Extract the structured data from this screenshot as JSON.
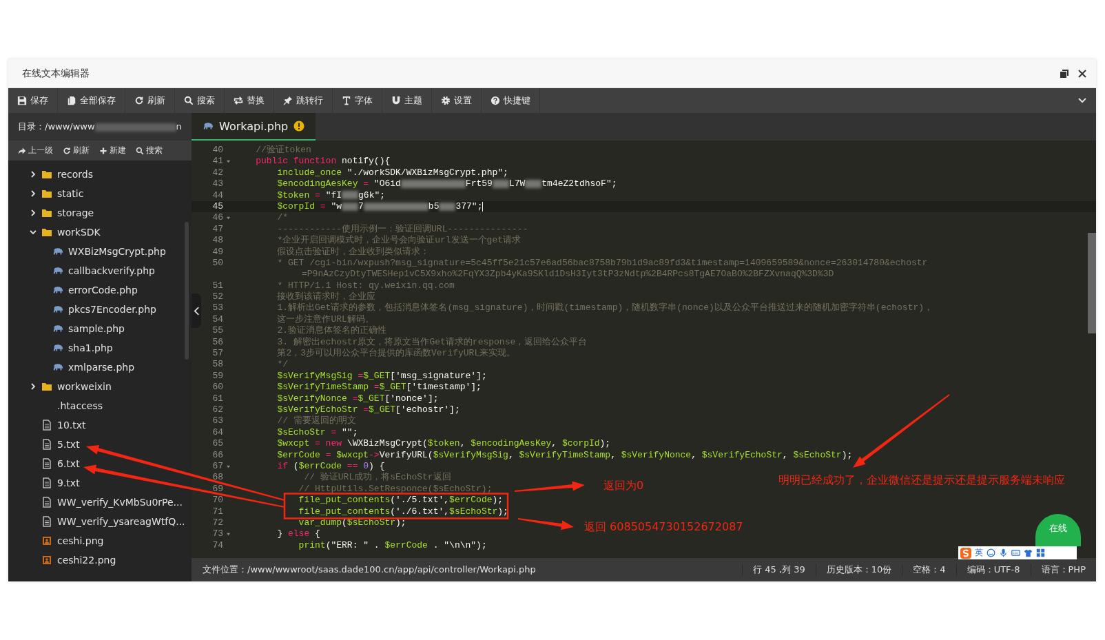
{
  "window": {
    "title": "在线文本编辑器"
  },
  "toolbar": [
    {
      "kind": "save",
      "label": "保存"
    },
    {
      "kind": "save-all",
      "label": "全部保存"
    },
    {
      "kind": "refresh",
      "label": "刷新"
    },
    {
      "kind": "search",
      "label": "搜索"
    },
    {
      "kind": "replace",
      "label": "替换"
    },
    {
      "kind": "goto",
      "label": "跳转行"
    },
    {
      "kind": "font",
      "label": "字体"
    },
    {
      "kind": "theme",
      "label": "主题"
    },
    {
      "kind": "settings",
      "label": "设置"
    },
    {
      "kind": "help",
      "label": "快捷键"
    }
  ],
  "sidebar": {
    "path": {
      "label": "目录：/www/www",
      "tail": "n"
    },
    "tools": [
      {
        "kind": "up",
        "label": "上一级"
      },
      {
        "kind": "refresh",
        "label": "刷新"
      },
      {
        "kind": "new",
        "label": "新建"
      },
      {
        "kind": "search",
        "label": "搜索"
      }
    ],
    "tree": [
      {
        "name": "records",
        "kind": "folder",
        "expanded": false
      },
      {
        "name": "static",
        "kind": "folder",
        "expanded": false
      },
      {
        "name": "storage",
        "kind": "folder",
        "expanded": false
      },
      {
        "name": "workSDK",
        "kind": "folder",
        "expanded": true,
        "children": [
          {
            "name": "WXBizMsgCrypt.php",
            "kind": "php"
          },
          {
            "name": "callbackverify.php",
            "kind": "php"
          },
          {
            "name": "errorCode.php",
            "kind": "php"
          },
          {
            "name": "pkcs7Encoder.php",
            "kind": "php"
          },
          {
            "name": "sample.php",
            "kind": "php"
          },
          {
            "name": "sha1.php",
            "kind": "php"
          },
          {
            "name": "xmlparse.php",
            "kind": "php"
          }
        ]
      },
      {
        "name": "workweixin",
        "kind": "folder",
        "expanded": false
      },
      {
        "name": ".htaccess",
        "kind": "plain"
      },
      {
        "name": "10.txt",
        "kind": "text"
      },
      {
        "name": "5.txt",
        "kind": "text"
      },
      {
        "name": "6.txt",
        "kind": "text"
      },
      {
        "name": "9.txt",
        "kind": "text"
      },
      {
        "name": "WW_verify_KvMbSu0rPe...",
        "kind": "text"
      },
      {
        "name": "WW_verify_ysareagWtfQ...",
        "kind": "text"
      },
      {
        "name": "ceshi.png",
        "kind": "image"
      },
      {
        "name": "ceshi22.png",
        "kind": "image"
      }
    ]
  },
  "tabs": [
    {
      "label": "Workapi.php",
      "selected": true,
      "warning": true
    }
  ],
  "code": {
    "lines": [
      {
        "number": "40",
        "current": false,
        "segments": [
          {
            "text": "    //验证token",
            "kind": "comment"
          }
        ]
      },
      {
        "number": "41",
        "fold": true,
        "current": false,
        "segments": [
          {
            "text": "    public function ",
            "kind": "keyword"
          },
          {
            "text": "notify(){",
            "kind": "plain"
          }
        ]
      },
      {
        "number": "42",
        "current": false,
        "segments": [
          {
            "text": "        include_once ",
            "kind": "var"
          },
          {
            "text": "\"./workSDK/WXBizMsgCrypt.php\";",
            "kind": "plain"
          }
        ]
      },
      {
        "number": "43",
        "current": false,
        "segments": [
          {
            "text": "        $encodingAesKey",
            "kind": "var"
          },
          {
            "text": " = ",
            "kind": "keyword"
          },
          {
            "text": "\"O6id",
            "kind": "plain"
          },
          {
            "kind": "redacted-long"
          },
          {
            "text": "Frt59",
            "kind": "plain"
          },
          {
            "kind": "redacted-short"
          },
          {
            "text": "L7W",
            "kind": "plain"
          },
          {
            "kind": "redacted-short"
          },
          {
            "text": "tm4eZ2tdhsoF\";",
            "kind": "plain"
          }
        ]
      },
      {
        "number": "44",
        "current": false,
        "segments": [
          {
            "text": "        $token",
            "kind": "var"
          },
          {
            "text": " = ",
            "kind": "keyword"
          },
          {
            "text": "\"fI",
            "kind": "plain"
          },
          {
            "kind": "redacted-short"
          },
          {
            "text": "g6k\";",
            "kind": "plain"
          }
        ]
      },
      {
        "number": "45",
        "current": true,
        "segments": [
          {
            "text": "        $corpId",
            "kind": "var"
          },
          {
            "text": " = ",
            "kind": "keyword"
          },
          {
            "text": "\"w",
            "kind": "plain"
          },
          {
            "kind": "redacted-short"
          },
          {
            "text": "7",
            "kind": "plain"
          },
          {
            "kind": "redacted-long"
          },
          {
            "text": "b5",
            "kind": "plain"
          },
          {
            "kind": "redacted-short"
          },
          {
            "text": "377\";",
            "kind": "plain"
          }
        ]
      },
      {
        "number": "46",
        "fold": true,
        "current": false,
        "segments": [
          {
            "text": "        /*",
            "kind": "comment"
          }
        ]
      },
      {
        "number": "47",
        "current": false,
        "segments": [
          {
            "text": "        ------------使用示例一：验证回调URL---------------",
            "kind": "comment"
          }
        ]
      },
      {
        "number": "48",
        "current": false,
        "segments": [
          {
            "text": "        *企业开启回调模式时，企业号会向验证url发送一个get请求",
            "kind": "comment"
          }
        ]
      },
      {
        "number": "49",
        "current": false,
        "segments": [
          {
            "text": "        假设点击验证时，企业收到类似请求：",
            "kind": "comment"
          }
        ]
      },
      {
        "number": "50",
        "current": false,
        "segments": [
          {
            "text": "        * GET /cgi-bin/wxpush?msg_signature=5c45ff5e21c57e6ad56bac8758b79b1d9ac89fd3&timestamp=1409659589&nonce=263014780&echostr",
            "kind": "comment"
          }
        ],
        "wrap": "=P9nAzCzyDtyTWESHep1vC5X9xho%2FqYX3Zpb4yKa9SKld1DsH3Iyt3tP3zNdtp%2B4RPcs8TgAE7OaBO%2BFZXvnaqQ%3D%3D"
      },
      {
        "number": "51",
        "current": false,
        "segments": [
          {
            "text": "        * HTTP/1.1 Host: qy.weixin.qq.com",
            "kind": "comment"
          }
        ]
      },
      {
        "number": "52",
        "current": false,
        "segments": [
          {
            "text": "        接收到该请求时，企业应",
            "kind": "comment"
          }
        ]
      },
      {
        "number": "53",
        "current": false,
        "segments": [
          {
            "text": "        1.解析出Get请求的参数，包括消息体签名(msg_signature)，时间戳(timestamp)，随机数字串(nonce)以及公众平台推送过来的随机加密字符串(echostr)，",
            "kind": "comment"
          }
        ]
      },
      {
        "number": "54",
        "current": false,
        "segments": [
          {
            "text": "        这一步注意作URL解码。",
            "kind": "comment"
          }
        ]
      },
      {
        "number": "55",
        "current": false,
        "segments": [
          {
            "text": "        2.验证消息体签名的正确性",
            "kind": "comment"
          }
        ]
      },
      {
        "number": "56",
        "current": false,
        "segments": [
          {
            "text": "        3. 解密出echostr原文，将原文当作Get请求的response，返回给公众平台",
            "kind": "comment"
          }
        ]
      },
      {
        "number": "57",
        "current": false,
        "segments": [
          {
            "text": "        第2，3步可以用公众平台提供的库函数VerifyURL来实现。",
            "kind": "comment"
          }
        ]
      },
      {
        "number": "58",
        "current": false,
        "segments": [
          {
            "text": "        */",
            "kind": "comment"
          }
        ]
      },
      {
        "number": "59",
        "current": false,
        "segments": [
          {
            "text": "        $sVerifyMsgSig ",
            "kind": "var"
          },
          {
            "text": "=",
            "kind": "keyword"
          },
          {
            "text": "$_GET",
            "kind": "var"
          },
          {
            "text": "['msg_signature'];",
            "kind": "plain"
          }
        ]
      },
      {
        "number": "60",
        "current": false,
        "segments": [
          {
            "text": "        $sVerifyTimeStamp ",
            "kind": "var"
          },
          {
            "text": "=",
            "kind": "keyword"
          },
          {
            "text": "$_GET",
            "kind": "var"
          },
          {
            "text": "['timestamp'];",
            "kind": "plain"
          }
        ]
      },
      {
        "number": "61",
        "current": false,
        "segments": [
          {
            "text": "        $sVerifyNonce ",
            "kind": "var"
          },
          {
            "text": "=",
            "kind": "keyword"
          },
          {
            "text": "$_GET",
            "kind": "var"
          },
          {
            "text": "['nonce'];",
            "kind": "plain"
          }
        ]
      },
      {
        "number": "62",
        "current": false,
        "segments": [
          {
            "text": "        $sVerifyEchoStr ",
            "kind": "var"
          },
          {
            "text": "=",
            "kind": "keyword"
          },
          {
            "text": "$_GET",
            "kind": "var"
          },
          {
            "text": "['echostr'];",
            "kind": "plain"
          }
        ]
      },
      {
        "number": "63",
        "current": false,
        "segments": [
          {
            "text": "        // 需要返回的明文",
            "kind": "comment"
          }
        ]
      },
      {
        "number": "64",
        "current": false,
        "segments": [
          {
            "text": "        $sEchoStr",
            "kind": "var"
          },
          {
            "text": " = ",
            "kind": "keyword"
          },
          {
            "text": "\"\";",
            "kind": "plain"
          }
        ]
      },
      {
        "number": "65",
        "current": false,
        "segments": [
          {
            "text": "        $wxcpt",
            "kind": "var"
          },
          {
            "text": " = new ",
            "kind": "keyword"
          },
          {
            "text": "\\WXBizMsgCrypt(",
            "kind": "plain"
          },
          {
            "text": "$token",
            "kind": "var"
          },
          {
            "text": ", ",
            "kind": "plain"
          },
          {
            "text": "$encodingAesKey",
            "kind": "var"
          },
          {
            "text": ", ",
            "kind": "plain"
          },
          {
            "text": "$corpId",
            "kind": "var"
          },
          {
            "text": ");",
            "kind": "plain"
          }
        ]
      },
      {
        "number": "66",
        "current": false,
        "segments": [
          {
            "text": "        $errCode",
            "kind": "var"
          },
          {
            "text": " = ",
            "kind": "keyword"
          },
          {
            "text": "$wxcpt",
            "kind": "var"
          },
          {
            "text": "->",
            "kind": "keyword"
          },
          {
            "text": "VerifyURL(",
            "kind": "plain"
          },
          {
            "text": "$sVerifyMsgSig",
            "kind": "var"
          },
          {
            "text": ", ",
            "kind": "plain"
          },
          {
            "text": "$sVerifyTimeStamp",
            "kind": "var"
          },
          {
            "text": ", ",
            "kind": "plain"
          },
          {
            "text": "$sVerifyNonce",
            "kind": "var"
          },
          {
            "text": ", ",
            "kind": "plain"
          },
          {
            "text": "$sVerifyEchoStr",
            "kind": "var"
          },
          {
            "text": ", ",
            "kind": "plain"
          },
          {
            "text": "$sEchoStr",
            "kind": "var"
          },
          {
            "text": ");",
            "kind": "plain"
          }
        ]
      },
      {
        "number": "67",
        "fold": true,
        "current": false,
        "segments": [
          {
            "text": "        if",
            "kind": "keyword"
          },
          {
            "text": " (",
            "kind": "plain"
          },
          {
            "text": "$errCode",
            "kind": "var"
          },
          {
            "text": " == ",
            "kind": "keyword"
          },
          {
            "text": "0",
            "kind": "number"
          },
          {
            "text": ") {",
            "kind": "plain"
          }
        ]
      },
      {
        "number": "68",
        "current": false,
        "segments": [
          {
            "text": "             // 验证URL成功，将sEchoStr返回",
            "kind": "comment"
          }
        ]
      },
      {
        "number": "69",
        "current": false,
        "segments": [
          {
            "text": "            // HttpUtils.SetResponce($sEchoStr);",
            "kind": "comment"
          }
        ]
      },
      {
        "number": "70",
        "current": false,
        "segments": [
          {
            "text": "            file_put_contents",
            "kind": "var"
          },
          {
            "text": "('./5.txt',",
            "kind": "plain"
          },
          {
            "text": "$errCode",
            "kind": "var"
          },
          {
            "text": ");",
            "kind": "plain"
          }
        ]
      },
      {
        "number": "71",
        "current": false,
        "segments": [
          {
            "text": "            file_put_contents",
            "kind": "var"
          },
          {
            "text": "('./6.txt',",
            "kind": "plain"
          },
          {
            "text": "$sEchoStr",
            "kind": "var"
          },
          {
            "text": ");",
            "kind": "plain"
          }
        ]
      },
      {
        "number": "72",
        "current": false,
        "segments": [
          {
            "text": "            var_dump",
            "kind": "var"
          },
          {
            "text": "(",
            "kind": "plain"
          },
          {
            "text": "$sEchoStr",
            "kind": "var"
          },
          {
            "text": ");",
            "kind": "plain"
          }
        ]
      },
      {
        "number": "73",
        "fold": true,
        "current": false,
        "segments": [
          {
            "text": "        } ",
            "kind": "plain"
          },
          {
            "text": "else",
            "kind": "keyword"
          },
          {
            "text": " {",
            "kind": "plain"
          }
        ]
      },
      {
        "number": "74",
        "current": false,
        "segments": [
          {
            "text": "            print",
            "kind": "var"
          },
          {
            "text": "(\"ERR: \" . ",
            "kind": "plain"
          },
          {
            "text": "$errCode",
            "kind": "var"
          },
          {
            "text": " . \"\\n\\n\");",
            "kind": "plain"
          }
        ]
      }
    ]
  },
  "status_bar": {
    "file_path": "文件位置：/www/wwwroot/saas.dade100.cn/app/api/controller/Workapi.php",
    "items": [
      "行 45 ,列 39",
      "历史版本：10份",
      "空格：4",
      "编码：UTF-8",
      "语言：PHP"
    ]
  },
  "annotations": [
    {
      "text": "返回为0"
    },
    {
      "text": "返回  6085054730152672087"
    },
    {
      "text": "明明已经成功了，企业微信还是提示还是提示服务端未响应"
    }
  ],
  "chat_bubble": {
    "label": "在线"
  },
  "ime_toolbar": {
    "language": "英"
  }
}
